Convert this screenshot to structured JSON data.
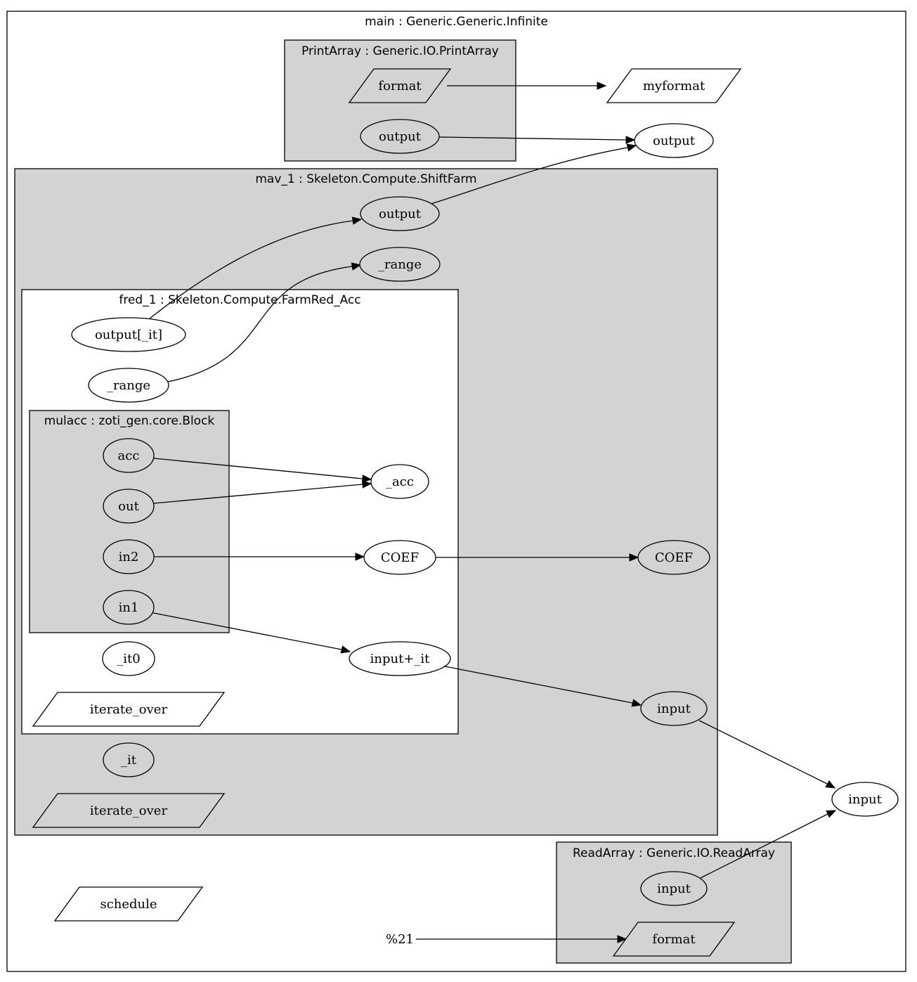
{
  "diagram": {
    "type": "dataflow-graph",
    "colors": {
      "cluster_fill_gray": "#d3d3d3",
      "cluster_fill_white": "#ffffff",
      "stroke": "#000000",
      "node_fill_white": "#ffffff"
    },
    "clusters": [
      {
        "id": "main",
        "label": "main : Generic.Generic.Infinite",
        "fill": "white"
      },
      {
        "id": "printarray",
        "label": "PrintArray : Generic.IO.PrintArray",
        "fill": "gray",
        "parent": "main"
      },
      {
        "id": "mav_1",
        "label": "mav_1 : Skeleton.Compute.ShiftFarm",
        "fill": "gray",
        "parent": "main"
      },
      {
        "id": "fred_1",
        "label": "fred_1 : Skeleton.Compute.FarmRed_Acc",
        "fill": "white",
        "parent": "mav_1"
      },
      {
        "id": "mulacc",
        "label": "mulacc : zoti_gen.core.Block",
        "fill": "gray",
        "parent": "fred_1"
      },
      {
        "id": "readarray",
        "label": "ReadArray : Generic.IO.ReadArray",
        "fill": "gray",
        "parent": "main"
      }
    ],
    "nodes": [
      {
        "id": "pa_format",
        "label": "format",
        "shape": "parallelogram",
        "cluster": "printarray"
      },
      {
        "id": "pa_output",
        "label": "output",
        "shape": "ellipse",
        "cluster": "printarray"
      },
      {
        "id": "myformat",
        "label": "myformat",
        "shape": "parallelogram",
        "cluster": "main"
      },
      {
        "id": "main_output",
        "label": "output",
        "shape": "ellipse",
        "cluster": "main"
      },
      {
        "id": "mav_output",
        "label": "output",
        "shape": "ellipse",
        "cluster": "mav_1"
      },
      {
        "id": "mav_range",
        "label": "_range",
        "shape": "ellipse",
        "cluster": "mav_1"
      },
      {
        "id": "fred_output_it",
        "label": "output[_it]",
        "shape": "ellipse",
        "cluster": "fred_1"
      },
      {
        "id": "fred_range",
        "label": "_range",
        "shape": "ellipse",
        "cluster": "fred_1"
      },
      {
        "id": "mul_acc",
        "label": "acc",
        "shape": "ellipse",
        "cluster": "mulacc"
      },
      {
        "id": "mul_out",
        "label": "out",
        "shape": "ellipse",
        "cluster": "mulacc"
      },
      {
        "id": "mul_in2",
        "label": "in2",
        "shape": "ellipse",
        "cluster": "mulacc"
      },
      {
        "id": "mul_in1",
        "label": "in1",
        "shape": "ellipse",
        "cluster": "mulacc"
      },
      {
        "id": "fred_acc",
        "label": "_acc",
        "shape": "ellipse",
        "cluster": "fred_1"
      },
      {
        "id": "fred_coef",
        "label": "COEF",
        "shape": "ellipse",
        "cluster": "fred_1"
      },
      {
        "id": "fred_input_it",
        "label": "input+_it",
        "shape": "ellipse",
        "cluster": "fred_1"
      },
      {
        "id": "fred_it0",
        "label": "_it0",
        "shape": "ellipse",
        "cluster": "fred_1"
      },
      {
        "id": "fred_iterate_over",
        "label": "iterate_over",
        "shape": "parallelogram",
        "cluster": "fred_1"
      },
      {
        "id": "mav_coef",
        "label": "COEF",
        "shape": "ellipse",
        "cluster": "mav_1"
      },
      {
        "id": "mav_input",
        "label": "input",
        "shape": "ellipse",
        "cluster": "mav_1"
      },
      {
        "id": "mav_it",
        "label": "_it",
        "shape": "ellipse",
        "cluster": "mav_1"
      },
      {
        "id": "mav_iterate_over",
        "label": "iterate_over",
        "shape": "parallelogram",
        "cluster": "mav_1"
      },
      {
        "id": "main_input",
        "label": "input",
        "shape": "ellipse",
        "cluster": "main"
      },
      {
        "id": "schedule",
        "label": "schedule",
        "shape": "parallelogram",
        "cluster": "main"
      },
      {
        "id": "ra_input",
        "label": "input",
        "shape": "ellipse",
        "cluster": "readarray"
      },
      {
        "id": "ra_format",
        "label": "format",
        "shape": "parallelogram",
        "cluster": "readarray"
      },
      {
        "id": "pct21",
        "label": "%21",
        "shape": "plaintext",
        "cluster": "main"
      }
    ],
    "edges": [
      {
        "from": "pa_format",
        "to": "myformat"
      },
      {
        "from": "pa_output",
        "to": "main_output"
      },
      {
        "from": "mav_output",
        "to": "main_output"
      },
      {
        "from": "fred_output_it",
        "to": "mav_output"
      },
      {
        "from": "fred_range",
        "to": "mav_range"
      },
      {
        "from": "mul_acc",
        "to": "fred_acc"
      },
      {
        "from": "mul_out",
        "to": "fred_acc"
      },
      {
        "from": "mul_in2",
        "to": "fred_coef"
      },
      {
        "from": "fred_coef",
        "to": "mav_coef"
      },
      {
        "from": "mul_in1",
        "to": "fred_input_it"
      },
      {
        "from": "fred_input_it",
        "to": "mav_input"
      },
      {
        "from": "mav_input",
        "to": "main_input"
      },
      {
        "from": "ra_input",
        "to": "main_input"
      },
      {
        "from": "pct21",
        "to": "ra_format"
      }
    ]
  }
}
